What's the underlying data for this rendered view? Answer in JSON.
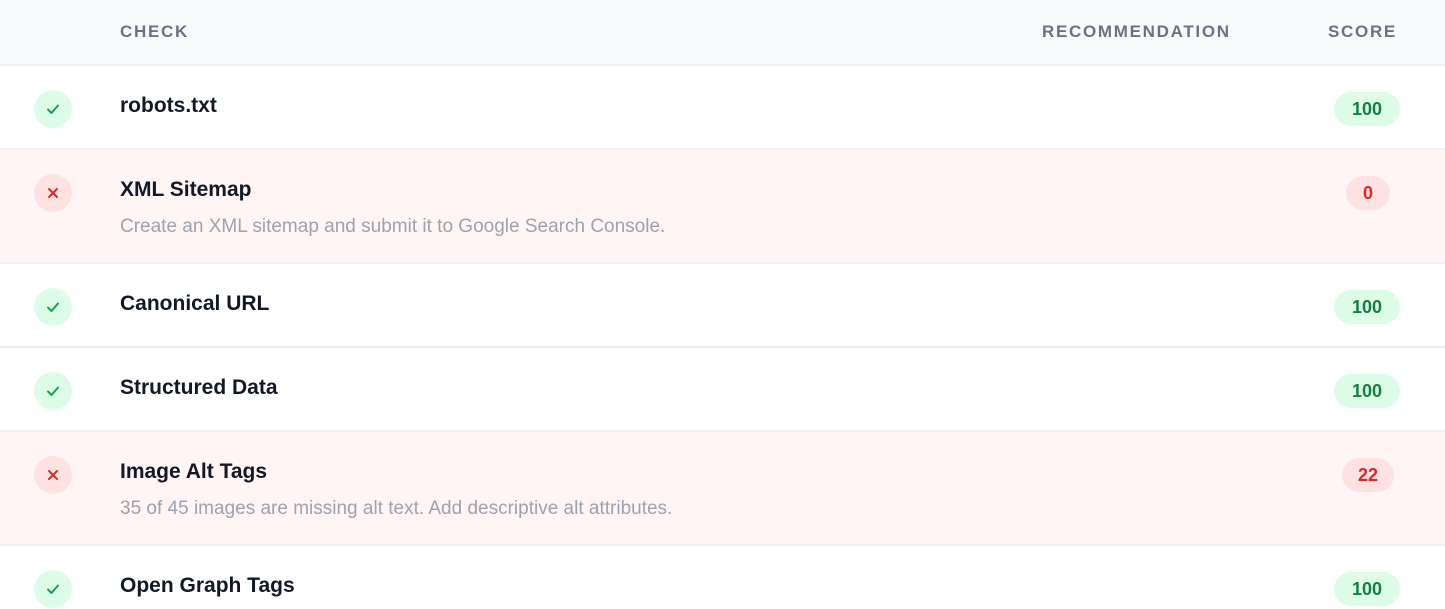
{
  "headers": {
    "check": "CHECK",
    "recommendation": "RECOMMENDATION",
    "score": "SCORE"
  },
  "colors": {
    "pass_bg": "#dcfce7",
    "pass_fg": "#15803d",
    "fail_bg": "#fee2e2",
    "fail_fg": "#dc2626",
    "fail_row_bg": "#fff5f5"
  },
  "checks": [
    {
      "status": "pass",
      "icon": "check-icon",
      "title": "robots.txt",
      "recommendation": "",
      "score": "100"
    },
    {
      "status": "fail",
      "icon": "x-icon",
      "title": "XML Sitemap",
      "recommendation": "Create an XML sitemap and submit it to Google Search Console.",
      "score": "0"
    },
    {
      "status": "pass",
      "icon": "check-icon",
      "title": "Canonical URL",
      "recommendation": "",
      "score": "100"
    },
    {
      "status": "pass",
      "icon": "check-icon",
      "title": "Structured Data",
      "recommendation": "",
      "score": "100"
    },
    {
      "status": "fail",
      "icon": "x-icon",
      "title": "Image Alt Tags",
      "recommendation": "35 of 45 images are missing alt text. Add descriptive alt attributes.",
      "score": "22"
    },
    {
      "status": "pass",
      "icon": "check-icon",
      "title": "Open Graph Tags",
      "recommendation": "",
      "score": "100"
    }
  ]
}
